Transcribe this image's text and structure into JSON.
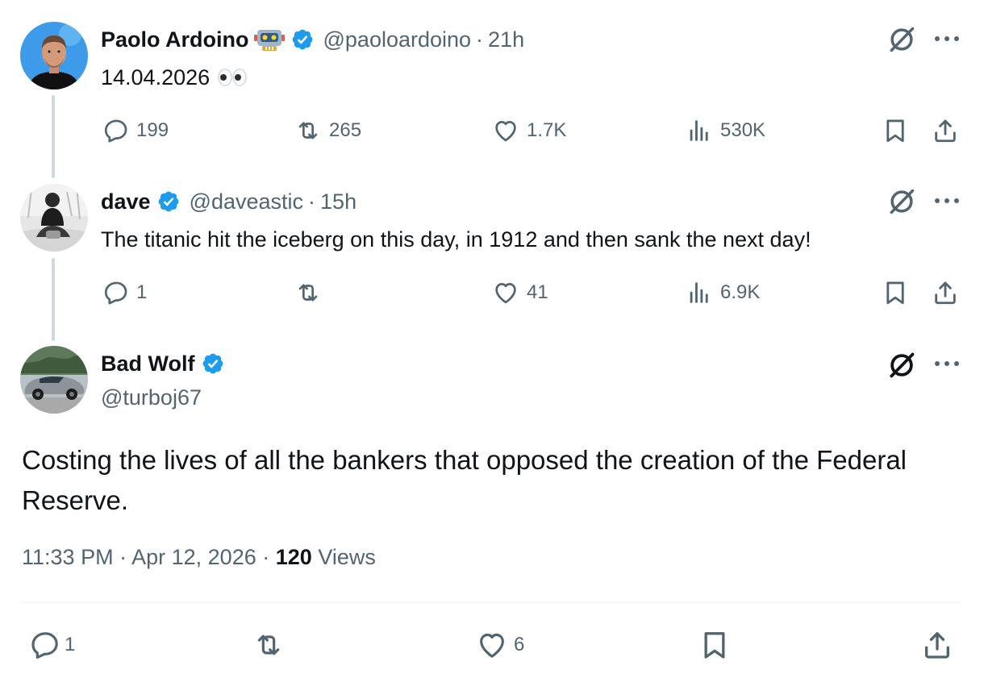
{
  "colors": {
    "accent": "#1d9bf0",
    "text": "#0f1419",
    "muted": "#536471",
    "line": "#cfd9de"
  },
  "tweets": [
    {
      "name": "Paolo Ardoino",
      "handle": "@paoloardoino",
      "time": "21h",
      "text": "14.04.2026",
      "emojis": [
        "robot-emoji",
        "eyes-emoji"
      ],
      "stats": {
        "replies": "199",
        "reposts": "265",
        "likes": "1.7K",
        "views": "530K"
      }
    },
    {
      "name": "dave",
      "handle": "@daveastic",
      "time": "15h",
      "text": "The titanic hit the iceberg on this day, in 1912 and then sank the next day!",
      "stats": {
        "replies": "1",
        "reposts": "",
        "likes": "41",
        "views": "6.9K"
      }
    }
  ],
  "main_tweet": {
    "name": "Bad Wolf",
    "handle": "@turboj67",
    "text": "Costing the lives of all the bankers that opposed the creation of the Federal Reserve.",
    "time": "11:33 PM",
    "date": "Apr 12, 2026",
    "views_count": "120",
    "views_label": "Views",
    "stats": {
      "replies": "1",
      "reposts": "",
      "likes": "6"
    }
  },
  "icons": [
    "verified-badge-icon",
    "grok-icon",
    "more-icon",
    "reply-icon",
    "repost-icon",
    "like-icon",
    "views-icon",
    "bookmark-icon",
    "share-icon"
  ]
}
